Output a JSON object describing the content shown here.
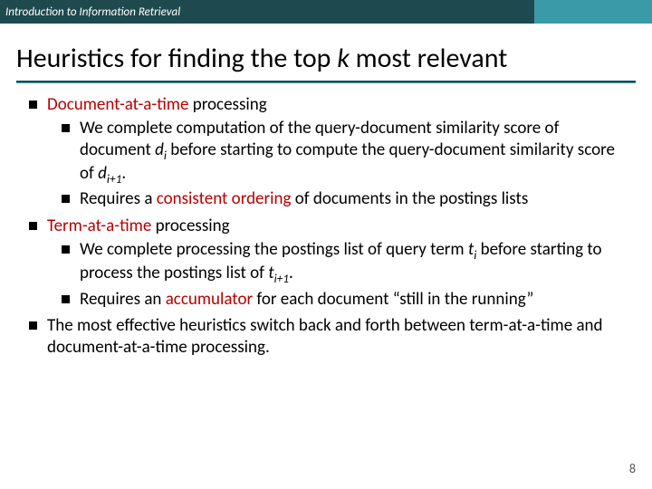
{
  "header": {
    "course": "Introduction to Information Retrieval"
  },
  "title": {
    "pre": "Heuristics for finding the top ",
    "k": "k",
    "post": " most relevant"
  },
  "bullets": {
    "doc_at_time": {
      "label_em": "Document-at-a-time",
      "label_rest": " processing",
      "sub1_a": "We complete computation of the query-document similarity score of document ",
      "sub1_di": "d",
      "sub1_di_sub": "i",
      "sub1_b": " before starting to compute the query-document similarity score of ",
      "sub1_di1": "d",
      "sub1_di1_sub": "i+1",
      "sub1_c": ".",
      "sub2_a": "Requires a ",
      "sub2_em": "consistent ordering",
      "sub2_b": " of documents in the postings lists"
    },
    "term_at_time": {
      "label_em": "Term-at-a-time",
      "label_rest": " processing",
      "sub1_a": "We complete processing the postings list of query term ",
      "sub1_ti": "t",
      "sub1_ti_sub": "i",
      "sub1_b": " before starting to process the postings list of ",
      "sub1_ti1": "t",
      "sub1_ti1_sub": "i+1",
      "sub1_c": ".",
      "sub2_a": "Requires an ",
      "sub2_em": "accumulator",
      "sub2_b": " for each document “still in the running”"
    },
    "conclusion": "The most effective heuristics switch back and forth between term-at-a-time and document-at-a-time processing."
  },
  "page_number": "8"
}
